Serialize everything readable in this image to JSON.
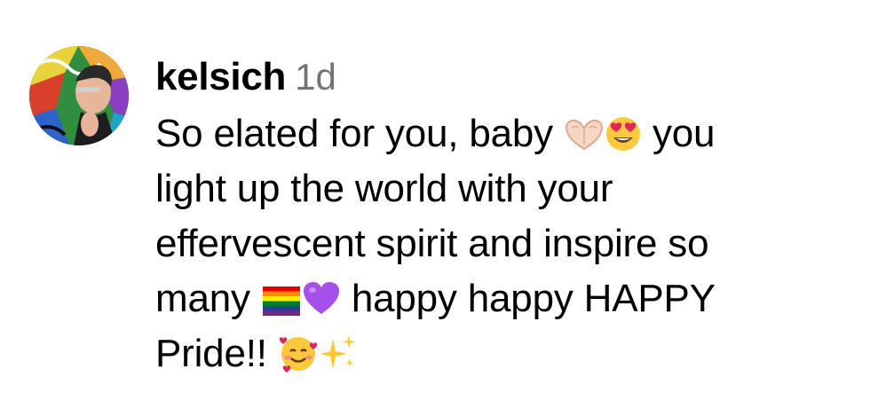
{
  "comment": {
    "username": "kelsich",
    "timestamp": "1d",
    "avatar_icon": "profile-photo-avatar",
    "segments": [
      {
        "type": "text",
        "value": "So elated for you, baby "
      },
      {
        "type": "emoji",
        "icon": "heart-hands-emoji"
      },
      {
        "type": "emoji",
        "icon": "heart-eyes-emoji"
      },
      {
        "type": "text",
        "value": " you\nlight up the world with your\neffervescent spirit and inspire so\nmany "
      },
      {
        "type": "emoji",
        "icon": "rainbow-flag-emoji"
      },
      {
        "type": "emoji",
        "icon": "purple-heart-emoji"
      },
      {
        "type": "text",
        "value": " happy happy HAPPY\nPride!! "
      },
      {
        "type": "emoji",
        "icon": "smiling-face-with-hearts-emoji"
      },
      {
        "type": "emoji",
        "icon": "sparkles-emoji"
      }
    ]
  },
  "colors": {
    "text": "#000000",
    "timestamp": "#737373",
    "background": "#ffffff"
  }
}
